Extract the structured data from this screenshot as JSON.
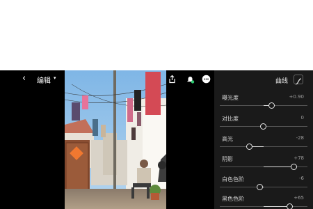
{
  "toolbar": {
    "back_glyph": "‹",
    "edit_label": "编辑",
    "edit_caret": "▾",
    "icons": [
      "help-icon",
      "share-icon",
      "notification-icon",
      "more-icon"
    ]
  },
  "panel": {
    "title": "曲线",
    "sliders": [
      {
        "label": "曝光度",
        "value": "+0.90",
        "level": 0.62
      },
      {
        "label": "对比度",
        "value": "0",
        "level": 0.5
      },
      {
        "label": "高光",
        "value": "-28",
        "level": 0.36
      },
      {
        "label": "阴影",
        "value": "+78",
        "level": 0.89
      },
      {
        "label": "白色色阶",
        "value": "-6",
        "level": 0.47
      },
      {
        "label": "黑色色阶",
        "value": "+65",
        "level": 0.83
      }
    ]
  },
  "colors": {
    "panel_bg": "#1a1a1a",
    "app_bg": "#000000",
    "accent_green": "#2ecc71",
    "shirt_red": "#d44a55",
    "door_sign": "#f07830"
  }
}
